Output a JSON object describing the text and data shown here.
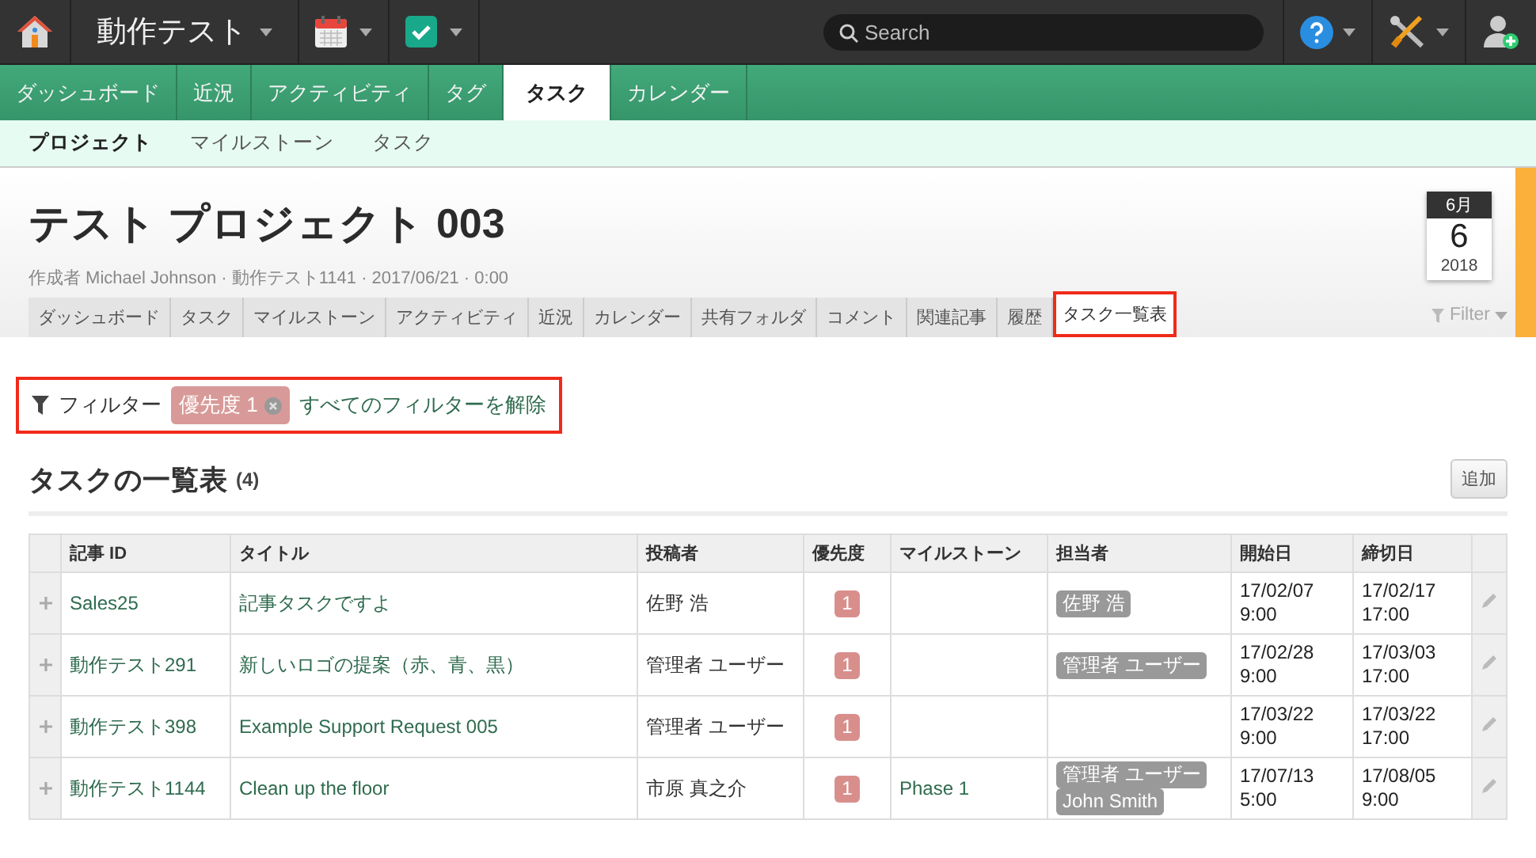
{
  "topbar": {
    "workspace": "動作テスト",
    "search": {
      "placeholder": "Search"
    }
  },
  "main_nav": [
    {
      "label": "ダッシュボード",
      "selected": false
    },
    {
      "label": "近況",
      "selected": false
    },
    {
      "label": "アクティビティ",
      "selected": false
    },
    {
      "label": "タグ",
      "selected": false
    },
    {
      "label": "タスク",
      "selected": true
    },
    {
      "label": "カレンダー",
      "selected": false
    }
  ],
  "sub_nav": [
    {
      "label": "プロジェクト",
      "selected": true
    },
    {
      "label": "マイルストーン",
      "selected": false
    },
    {
      "label": "タスク",
      "selected": false
    }
  ],
  "project": {
    "title": "テスト プロジェクト 003",
    "meta": "作成者 Michael Johnson · 動作テスト1141 · 2017/06/21 · 0:00",
    "tabs": [
      {
        "label": "ダッシュボード",
        "selected": false
      },
      {
        "label": "タスク",
        "selected": false
      },
      {
        "label": "マイルストーン",
        "selected": false
      },
      {
        "label": "アクティビティ",
        "selected": false
      },
      {
        "label": "近況",
        "selected": false
      },
      {
        "label": "カレンダー",
        "selected": false
      },
      {
        "label": "共有フォルダ",
        "selected": false
      },
      {
        "label": "コメント",
        "selected": false
      },
      {
        "label": "関連記事",
        "selected": false
      },
      {
        "label": "履歴",
        "selected": false
      },
      {
        "label": "タスク一覧表",
        "selected": true
      }
    ],
    "date": {
      "month": "6月",
      "day": "6",
      "year": "2018"
    },
    "filter_menu": "Filter"
  },
  "filters": {
    "label": "フィルター",
    "chips": [
      {
        "label": "優先度 1"
      }
    ],
    "clear_link": "すべてのフィルターを解除"
  },
  "task_list": {
    "title": "タスクの一覧表",
    "count": "(4)",
    "add_button": "追加",
    "columns": [
      "記事 ID",
      "タイトル",
      "投稿者",
      "優先度",
      "マイルストーン",
      "担当者",
      "開始日",
      "締切日"
    ],
    "rows": [
      {
        "id": "Sales25",
        "title": "記事タスクですよ",
        "poster": "佐野 浩",
        "priority": "1",
        "assignees": [
          "佐野 浩"
        ],
        "start": [
          "17/02/07",
          "9:00"
        ],
        "due": [
          "17/02/17",
          "17:00"
        ]
      },
      {
        "id": "動作テスト291",
        "title": "新しいロゴの提案（赤、青、黒）",
        "poster": "管理者 ユーザー",
        "priority": "1",
        "assignees": [
          "管理者 ユーザー"
        ],
        "start": [
          "17/02/28",
          "9:00"
        ],
        "due": [
          "17/03/03",
          "17:00"
        ]
      },
      {
        "id": "動作テスト398",
        "title": "Example Support Request 005",
        "poster": "管理者 ユーザー",
        "priority": "1",
        "start": [
          "17/03/22",
          "9:00"
        ],
        "due": [
          "17/03/22",
          "17:00"
        ]
      },
      {
        "id": "動作テスト1144",
        "title": "Clean up the floor",
        "poster": "市原 真之介",
        "priority": "1",
        "milestone": "Phase 1",
        "assignees": [
          "管理者 ユーザー",
          "John Smith"
        ],
        "start": [
          "17/07/13",
          "5:00"
        ],
        "due": [
          "17/08/05",
          "9:00"
        ]
      }
    ]
  }
}
